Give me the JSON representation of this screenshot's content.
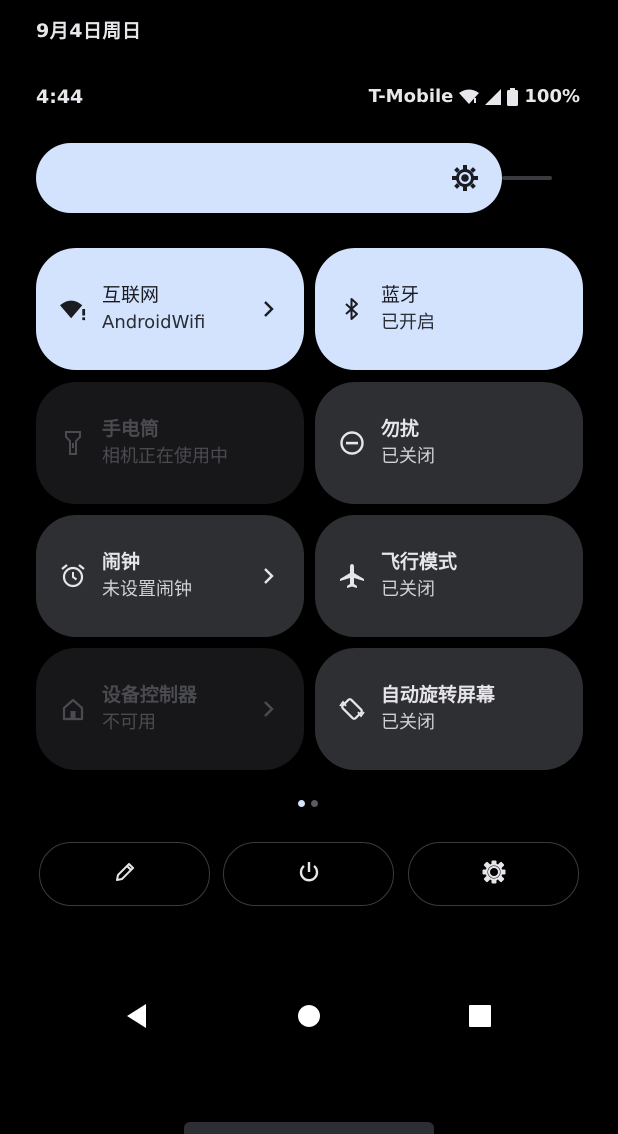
{
  "status_bar": {
    "date": "9月4日周日",
    "time": "4:44",
    "carrier": "T-Mobile",
    "battery": "100%",
    "icons": [
      "wifi-icon",
      "signal-icon",
      "battery-icon"
    ]
  },
  "brightness": {
    "level": 0.9,
    "icon": "brightness-icon"
  },
  "tiles": [
    {
      "name": "互联网",
      "sub": "AndroidWifi",
      "state": "on",
      "icon": "wifi-icon",
      "chevron": true
    },
    {
      "name": "蓝牙",
      "sub": "已开启",
      "state": "on",
      "icon": "bluetooth-icon",
      "chevron": false
    },
    {
      "name": "手电筒",
      "sub": "相机正在使用中",
      "state": "disabled",
      "icon": "flashlight-icon",
      "chevron": false
    },
    {
      "name": "勿扰",
      "sub": "已关闭",
      "state": "off",
      "icon": "do-not-disturb-icon",
      "chevron": false
    },
    {
      "name": "闹钟",
      "sub": "未设置闹钟",
      "state": "off",
      "icon": "alarm-icon",
      "chevron": true
    },
    {
      "name": "飞行模式",
      "sub": "已关闭",
      "state": "off",
      "icon": "airplane-icon",
      "chevron": false
    },
    {
      "name": "设备控制器",
      "sub": "不可用",
      "state": "disabled",
      "icon": "home-icon",
      "chevron": true
    },
    {
      "name": "自动旋转屏幕",
      "sub": "已关闭",
      "state": "off",
      "icon": "auto-rotate-icon",
      "chevron": false
    }
  ],
  "pager": {
    "pages": 2,
    "current": 1
  },
  "bottom_actions": [
    "edit-icon",
    "power-icon",
    "settings-icon"
  ],
  "nav_bar": [
    "back-icon",
    "home-icon",
    "recents-icon"
  ],
  "colors": {
    "tile_on": "#d3e3fd",
    "tile_off": "#2e2f33",
    "tile_disabled": "#171719",
    "background": "#000000"
  }
}
